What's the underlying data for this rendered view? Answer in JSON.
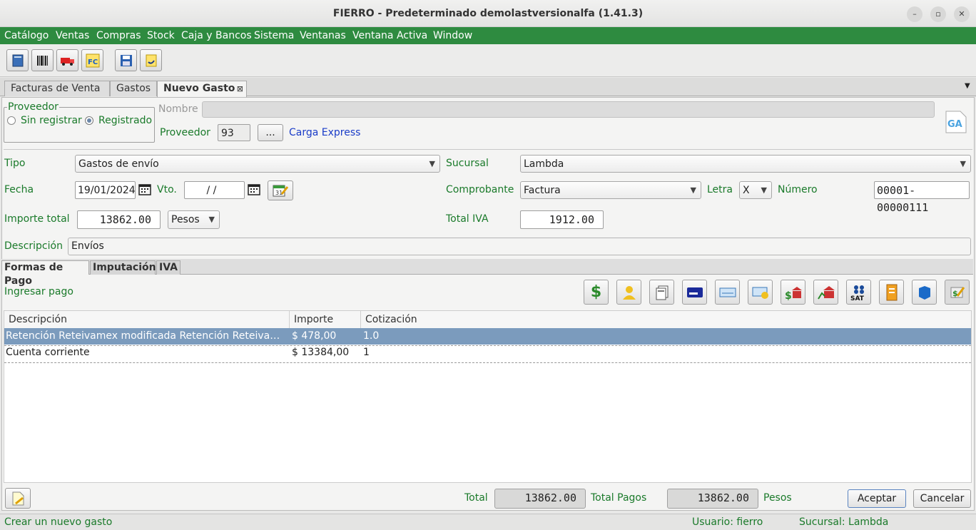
{
  "window": {
    "title": "FIERRO - Predeterminado demolastversionalfa (1.41.3)"
  },
  "menu": [
    "Catálogo",
    "Ventas",
    "Compras",
    "Stock",
    "Caja y Bancos",
    "Sistema",
    "Ventanas",
    "Ventana Activa",
    "Window"
  ],
  "tabs": [
    {
      "label": "Facturas de Venta"
    },
    {
      "label": "Gastos"
    },
    {
      "label": "Nuevo Gasto"
    }
  ],
  "proveedor_group": {
    "legend": "Proveedor",
    "option_unregistered": "Sin registrar",
    "option_registered": "Registrado",
    "selected": "Registrado"
  },
  "form": {
    "nombre_label": "Nombre",
    "nombre_value": "",
    "proveedor_label": "Proveedor",
    "proveedor_code": "93",
    "proveedor_lookup": "...",
    "proveedor_name": "Carga Express",
    "tipo_label": "Tipo",
    "tipo_value": "Gastos de envío",
    "sucursal_label": "Sucursal",
    "sucursal_value": "Lambda",
    "fecha_label": "Fecha",
    "fecha_value": "19/01/2024",
    "vto_label": "Vto.",
    "vto_value": " / /",
    "comprobante_label": "Comprobante",
    "comprobante_value": "Factura",
    "letra_label": "Letra",
    "letra_value": "X",
    "numero_label": "Número",
    "numero_value": "00001-00000111",
    "importe_label": "Importe total",
    "importe_value": "13862.00",
    "moneda_value": "Pesos",
    "totaliva_label": "Total IVA",
    "totaliva_value": "1912.00",
    "descripcion_label": "Descripción",
    "descripcion_value": "Envíos"
  },
  "subtabs": [
    "Formas de Pago",
    "Imputación",
    "IVA"
  ],
  "pagos": {
    "ingresar_label": "Ingresar pago",
    "columns": [
      "Descripción",
      "Importe",
      "Cotización"
    ],
    "rows": [
      {
        "descripcion": "Retención Reteivamex modificada Retención Reteivamex modificada",
        "importe": "$ 478,00",
        "cotizacion": "1.0",
        "selected": true
      },
      {
        "descripcion": "Cuenta corriente",
        "importe": "$ 13384,00",
        "cotizacion": "1",
        "selected": false
      }
    ]
  },
  "footer": {
    "total_label": "Total",
    "total_value": "13862.00",
    "total_pagos_label": "Total Pagos",
    "total_pagos_value": "13862.00",
    "moneda": "Pesos",
    "accept_label": "Aceptar",
    "cancel_label": "Cancelar"
  },
  "status": {
    "message": "Crear un nuevo gasto",
    "user": "Usuario: fierro",
    "branch": "Sucursal: Lambda"
  },
  "colors": {
    "menubar": "#2e8b40",
    "label_green": "#1a7a2a",
    "selection": "#7b9bbd",
    "link_blue": "#1a3cc8"
  }
}
